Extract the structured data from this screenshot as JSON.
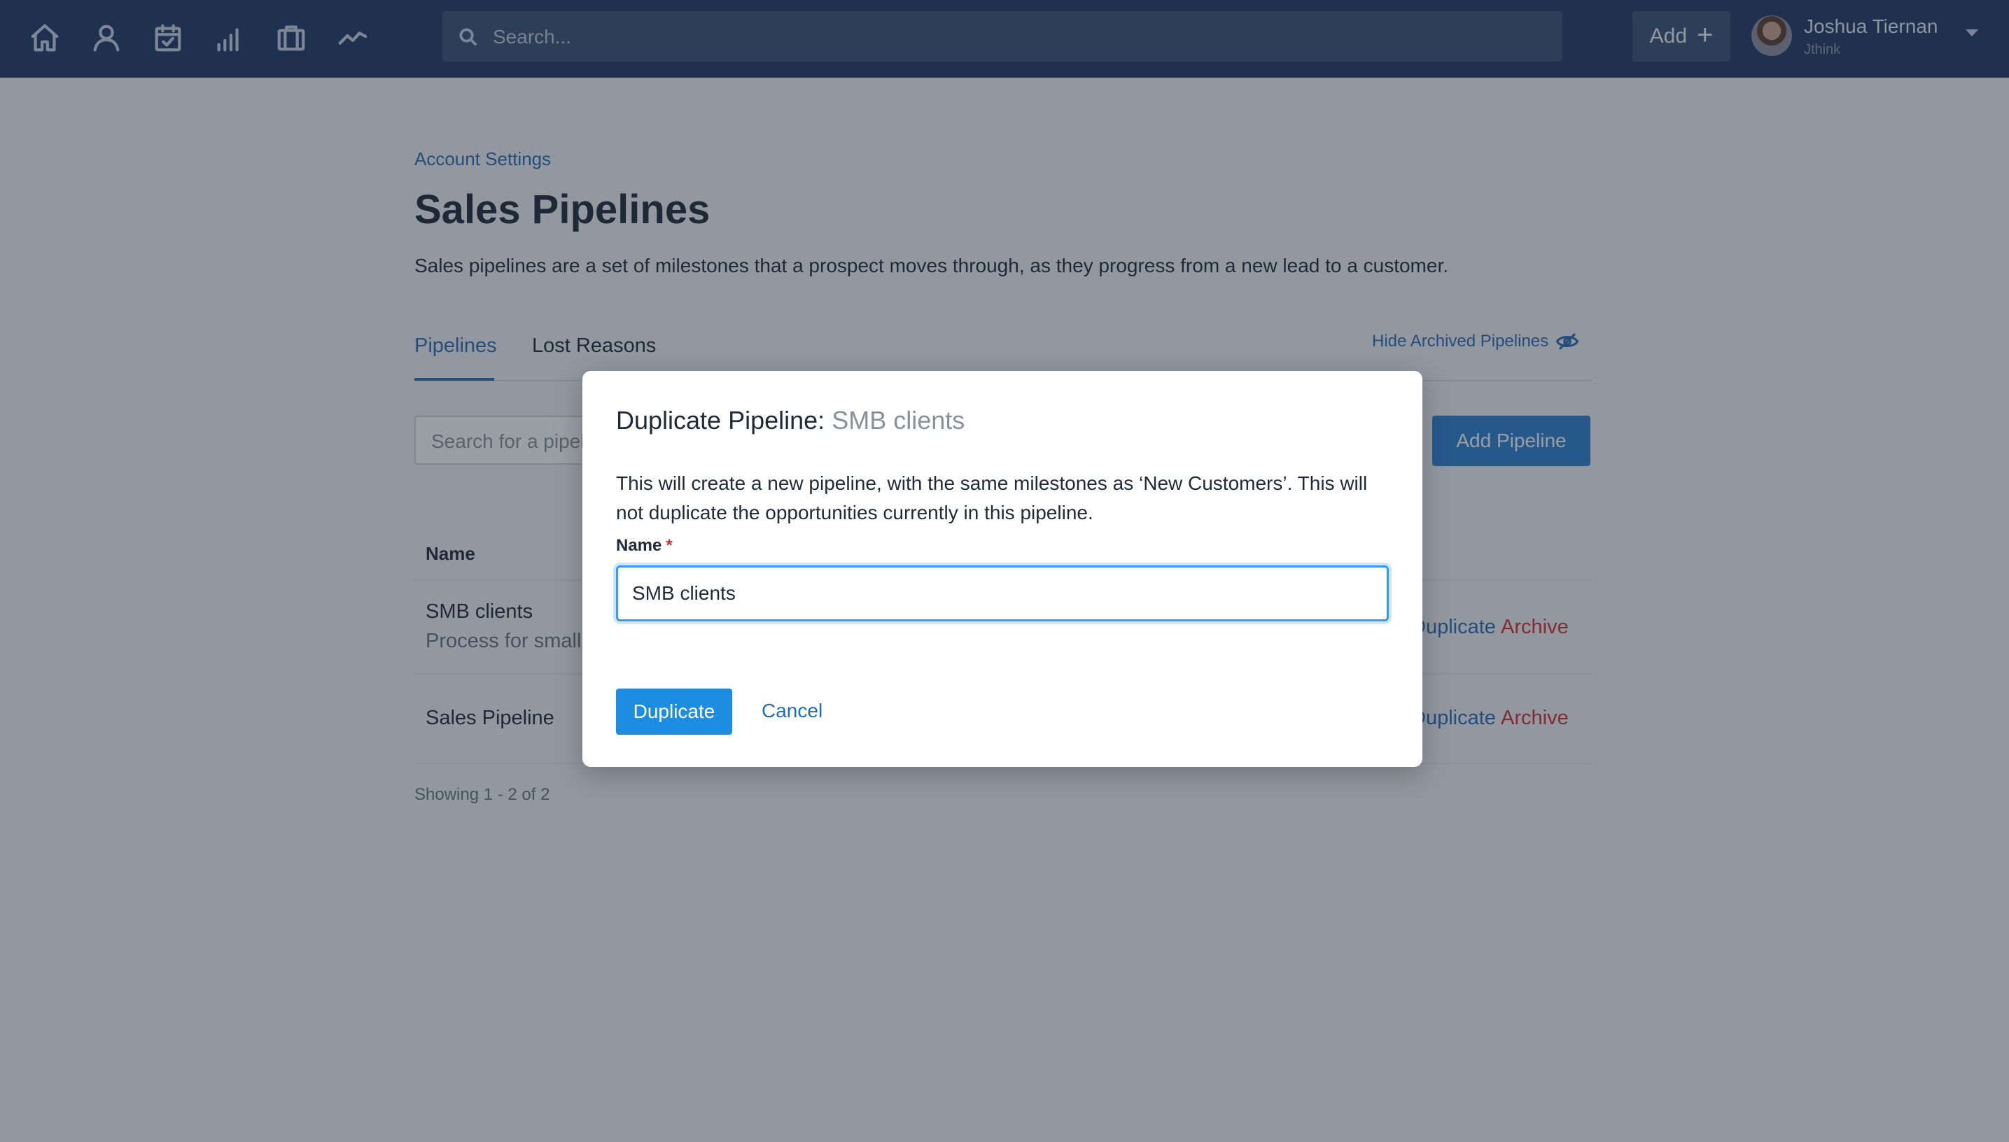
{
  "topbar": {
    "nav_icons": [
      "home-icon",
      "person-icon",
      "calendar-check-icon",
      "bar-chart-icon",
      "briefcase-icon",
      "activity-icon"
    ],
    "search_placeholder": "Search...",
    "add_label": "Add",
    "user": {
      "name": "Joshua Tiernan",
      "org": "Jthink"
    }
  },
  "page": {
    "breadcrumb": "Account Settings",
    "title": "Sales Pipelines",
    "description": "Sales pipelines are a set of milestones that a prospect moves through, as they progress from a new lead to a customer.",
    "tabs": [
      {
        "label": "Pipelines",
        "active": true
      },
      {
        "label": "Lost Reasons",
        "active": false
      }
    ],
    "hide_archived_label": "Hide Archived Pipelines",
    "pipeline_search_placeholder": "Search for a pipeline",
    "add_pipeline_label": "Add Pipeline",
    "table": {
      "header_name": "Name",
      "rows": [
        {
          "name": "SMB clients",
          "description": "Process for small",
          "duplicate_label": "Duplicate",
          "archive_label": "Archive"
        },
        {
          "name": "Sales Pipeline",
          "description": "",
          "duplicate_label": "Duplicate",
          "archive_label": "Archive"
        }
      ]
    },
    "showing": "Showing 1 - 2 of 2"
  },
  "modal": {
    "title_prefix": "Duplicate Pipeline:",
    "title_name": "SMB clients",
    "text": "This will create a new pipeline, with the same milestones as ‘New Customers’. This will not duplicate the opportunities currently in this pipeline.",
    "field_label": "Name",
    "required_mark": "*",
    "field_value": "SMB clients",
    "duplicate_label": "Duplicate",
    "cancel_label": "Cancel"
  },
  "colors": {
    "topbar": "#213a63",
    "link": "#2b6cb0",
    "danger": "#d12f2f",
    "primary": "#1c8de0"
  }
}
